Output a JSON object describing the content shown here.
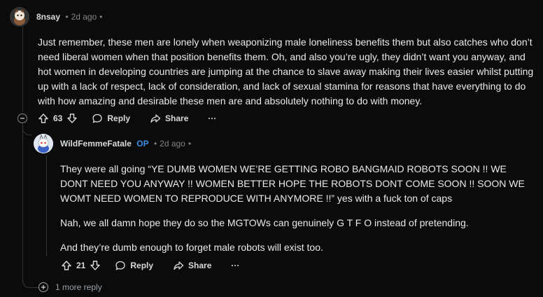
{
  "comment1": {
    "username": "8nsay",
    "time": "2d ago",
    "body": "Just remember, these men are lonely when weaponizing male loneliness benefits them but also catches who don’t need liberal women when that position benefits them. Oh, and also you’re ugly, they didn’t want you anyway, and hot women in developing countries are jumping at the chance to slave away making their lives easier whilst putting up with a lack of respect, lack of consideration, and lack of sexual stamina for reasons that have everything to do with how amazing and desirable these men are and absolutely nothing to do with money.",
    "votes": "63",
    "reply_label": "Reply",
    "share_label": "Share",
    "more_label": "···"
  },
  "comment2": {
    "username": "WildFemmeFatale",
    "op_badge": "OP",
    "time": "2d ago",
    "paragraphs": [
      "They were all going “YE DUMB WOMEN WE’RE GETTING ROBO BANGMAID ROBOTS SOON !! WE DONT NEED YOU ANYWAY !! WOMEN BETTER HOPE THE ROBOTS DONT COME SOON !! SOON WE WOMT NEED WOMEN TO REPRODUCE WITH ANYMORE !!” yes with a fuck ton of caps",
      "Nah, we all damn hope they do so the MGTOWs can genuinely G T F O instead of pretending.",
      "And they’re dumb enough to forget male robots will exist too."
    ],
    "votes": "21",
    "reply_label": "Reply",
    "share_label": "Share",
    "more_label": "···"
  },
  "more_replies_label": "1 more reply",
  "colors": {
    "background": "#0b0b0b",
    "text": "#d7dadc",
    "meta": "#818384",
    "op": "#3d8ee8",
    "thread": "#343536"
  }
}
